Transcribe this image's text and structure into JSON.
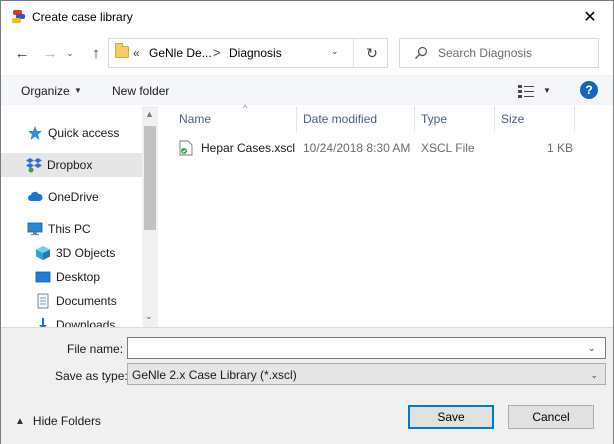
{
  "window": {
    "title": "Create case library"
  },
  "address": {
    "overflow_marker": "«",
    "crumbs": [
      "GeNle De...",
      "Diagnosis"
    ],
    "separator": ">"
  },
  "search": {
    "placeholder": "Search Diagnosis"
  },
  "toolbar": {
    "organize_label": "Organize",
    "new_folder_label": "New folder",
    "help_label": "?"
  },
  "navigation": {
    "items": [
      {
        "label": "Quick access",
        "icon": "star-icon"
      },
      {
        "label": "Dropbox",
        "icon": "dropbox-icon",
        "selected": true
      },
      {
        "label": "OneDrive",
        "icon": "cloud-icon"
      },
      {
        "label": "This PC",
        "icon": "computer-icon"
      },
      {
        "label": "3D Objects",
        "icon": "cube-icon"
      },
      {
        "label": "Desktop",
        "icon": "desktop-icon"
      },
      {
        "label": "Documents",
        "icon": "document-icon"
      },
      {
        "label": "Downloads",
        "icon": "download-icon"
      }
    ]
  },
  "file_list": {
    "columns": [
      "Name",
      "Date modified",
      "Type",
      "Size"
    ],
    "rows": [
      {
        "name": "Hepar Cases.xscl",
        "date_modified": "10/24/2018 8:30 AM",
        "type": "XSCL File",
        "size": "1 KB"
      }
    ]
  },
  "form": {
    "file_name_label": "File name:",
    "file_name_value": "",
    "save_as_type_label": "Save as type:",
    "save_as_type_value": "GeNle 2.x Case Library (*.xscl)"
  },
  "footer": {
    "hide_folders_label": "Hide Folders",
    "save_label": "Save",
    "cancel_label": "Cancel"
  },
  "colors": {
    "accent": "#0078d7",
    "help_icon": "#1565c0",
    "column_header_text": "#4c607a"
  }
}
